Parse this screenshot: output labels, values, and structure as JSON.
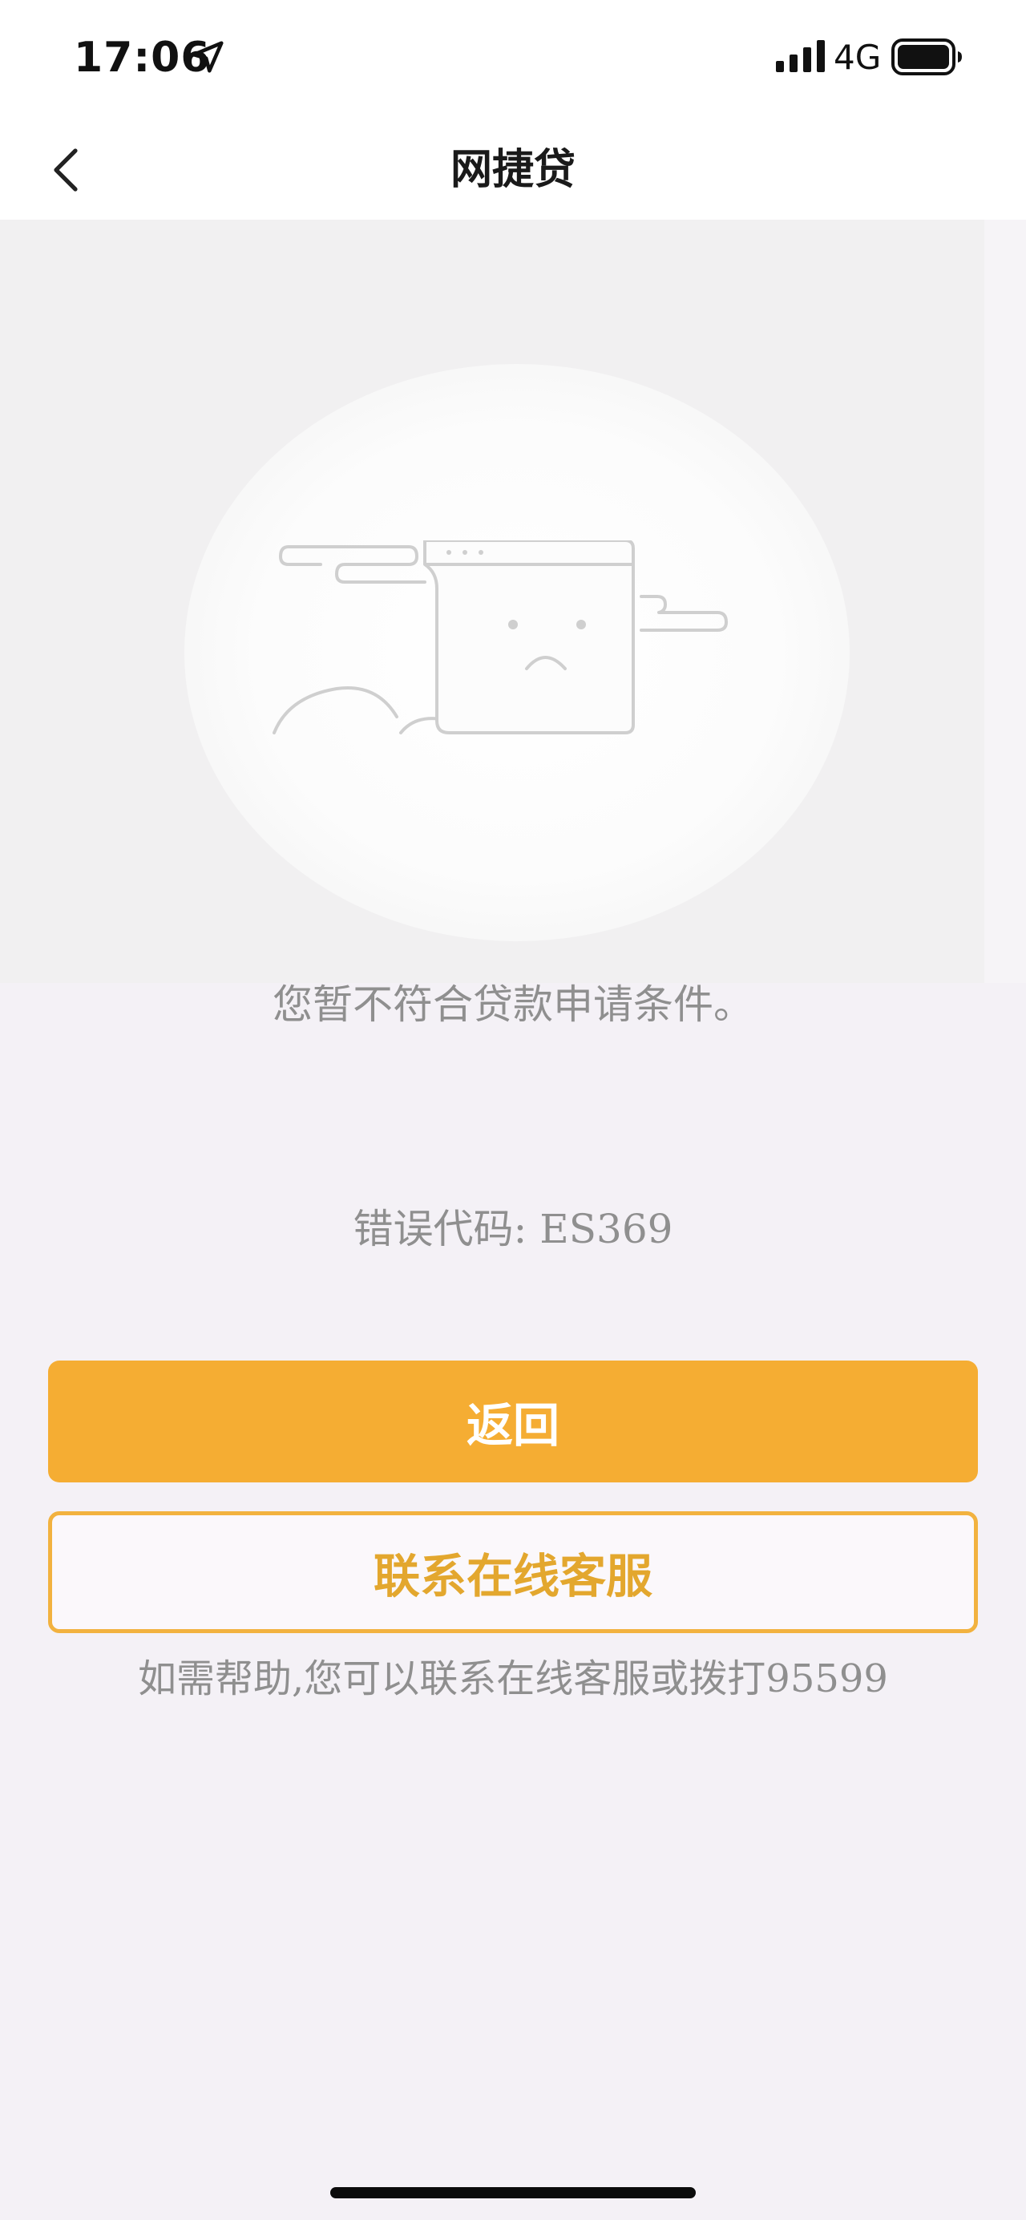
{
  "status_bar": {
    "time": "17:06",
    "network": "4G",
    "icons": [
      "location-arrow-icon",
      "cellular-signal-icon",
      "battery-icon"
    ]
  },
  "nav": {
    "title": "网捷贷",
    "back_icon": "chevron-left-icon"
  },
  "illustration": {
    "icon": "sad-browser-window-icon"
  },
  "messages": {
    "main": "您暂不符合贷款申请条件。",
    "error_code": "错误代码: ES369"
  },
  "buttons": {
    "primary_label": "返回",
    "secondary_label": "联系在线客服"
  },
  "help_text": "如需帮助,您可以联系在线客服或拨打95599",
  "colors": {
    "accent": "#f5ad33",
    "accent_text": "#e3a72e",
    "page_background": "#f4f1f6",
    "muted_text": "#8f8f8f"
  }
}
